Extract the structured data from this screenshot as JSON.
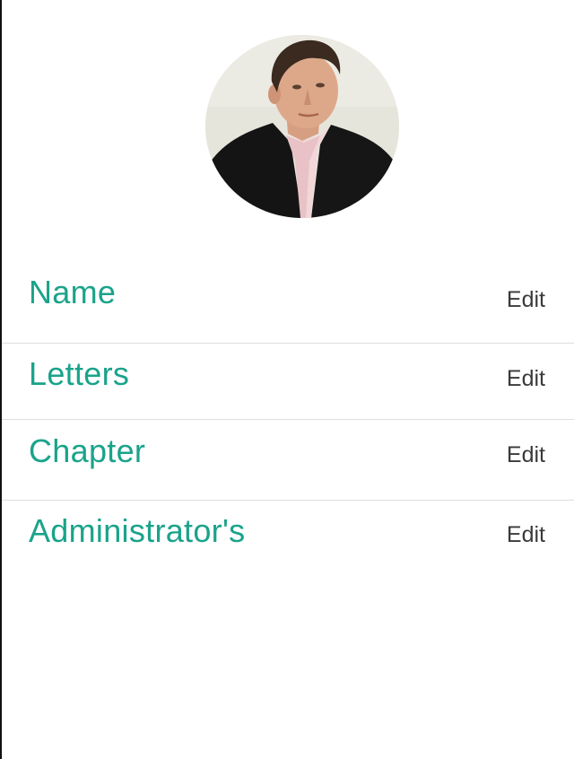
{
  "profile": {
    "avatar_icon": "profile-photo"
  },
  "fields": [
    {
      "label": "Name",
      "edit_label": "Edit"
    },
    {
      "label": "Letters",
      "edit_label": "Edit"
    },
    {
      "label": "Chapter",
      "edit_label": "Edit"
    },
    {
      "label": "Administrator's",
      "edit_label": "Edit"
    }
  ],
  "colors": {
    "label_accent": "#1aa38a",
    "edit_text": "#3a3a3a",
    "divider": "#dedede"
  }
}
